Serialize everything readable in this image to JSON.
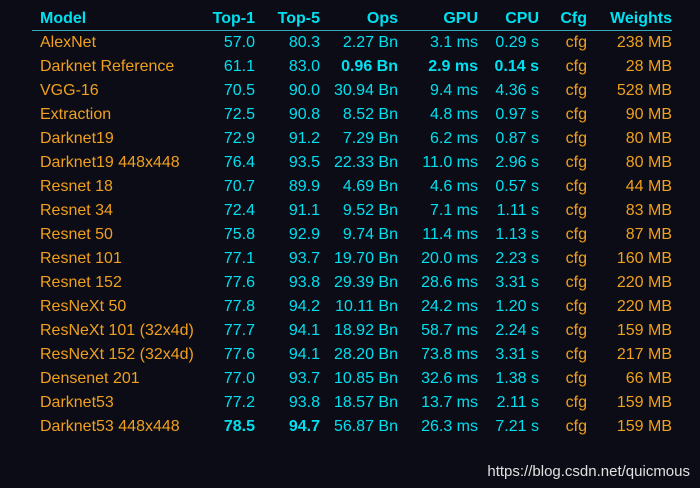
{
  "table": {
    "headers": [
      "Model",
      "Top-1",
      "Top-5",
      "Ops",
      "GPU",
      "CPU",
      "Cfg",
      "Weights"
    ],
    "rows": [
      [
        "AlexNet",
        "57.0",
        "80.3",
        "2.27 Bn",
        "3.1 ms",
        "0.29 s",
        "cfg",
        "238 MB"
      ],
      [
        "Darknet Reference",
        "61.1",
        "83.0",
        "0.96 Bn",
        "2.9 ms",
        "0.14 s",
        "cfg",
        "28 MB"
      ],
      [
        "VGG-16",
        "70.5",
        "90.0",
        "30.94 Bn",
        "9.4 ms",
        "4.36 s",
        "cfg",
        "528 MB"
      ],
      [
        "Extraction",
        "72.5",
        "90.8",
        "8.52 Bn",
        "4.8 ms",
        "0.97 s",
        "cfg",
        "90 MB"
      ],
      [
        "Darknet19",
        "72.9",
        "91.2",
        "7.29 Bn",
        "6.2 ms",
        "0.87 s",
        "cfg",
        "80 MB"
      ],
      [
        "Darknet19 448x448",
        "76.4",
        "93.5",
        "22.33 Bn",
        "11.0 ms",
        "2.96 s",
        "cfg",
        "80 MB"
      ],
      [
        "Resnet 18",
        "70.7",
        "89.9",
        "4.69 Bn",
        "4.6 ms",
        "0.57 s",
        "cfg",
        "44 MB"
      ],
      [
        "Resnet 34",
        "72.4",
        "91.1",
        "9.52 Bn",
        "7.1 ms",
        "1.11 s",
        "cfg",
        "83 MB"
      ],
      [
        "Resnet 50",
        "75.8",
        "92.9",
        "9.74 Bn",
        "11.4 ms",
        "1.13 s",
        "cfg",
        "87 MB"
      ],
      [
        "Resnet 101",
        "77.1",
        "93.7",
        "19.70 Bn",
        "20.0 ms",
        "2.23 s",
        "cfg",
        "160 MB"
      ],
      [
        "Resnet 152",
        "77.6",
        "93.8",
        "29.39 Bn",
        "28.6 ms",
        "3.31 s",
        "cfg",
        "220 MB"
      ],
      [
        "ResNeXt 50",
        "77.8",
        "94.2",
        "10.11 Bn",
        "24.2 ms",
        "1.20 s",
        "cfg",
        "220 MB"
      ],
      [
        "ResNeXt 101 (32x4d)",
        "77.7",
        "94.1",
        "18.92 Bn",
        "58.7 ms",
        "2.24 s",
        "cfg",
        "159 MB"
      ],
      [
        "ResNeXt 152 (32x4d)",
        "77.6",
        "94.1",
        "28.20 Bn",
        "73.8 ms",
        "3.31 s",
        "cfg",
        "217 MB"
      ],
      [
        "Densenet 201",
        "77.0",
        "93.7",
        "10.85 Bn",
        "32.6 ms",
        "1.38 s",
        "cfg",
        "66 MB"
      ],
      [
        "Darknet53",
        "77.2",
        "93.8",
        "18.57 Bn",
        "13.7 ms",
        "2.11 s",
        "cfg",
        "159 MB"
      ],
      [
        "Darknet53 448x448",
        "78.5",
        "94.7",
        "56.87 Bn",
        "26.3 ms",
        "7.21 s",
        "cfg",
        "159 MB"
      ]
    ],
    "bold_cells": [
      [
        1,
        3
      ],
      [
        1,
        4
      ],
      [
        1,
        5
      ],
      [
        16,
        1
      ],
      [
        16,
        2
      ]
    ]
  },
  "watermark": "https://blog.csdn.net/quicmous",
  "colors": {
    "background": "#0c0c16",
    "header_and_metrics": "#00e0f0",
    "model_cfg_weights": "#f0a020",
    "watermark": "#e0e0e0"
  }
}
